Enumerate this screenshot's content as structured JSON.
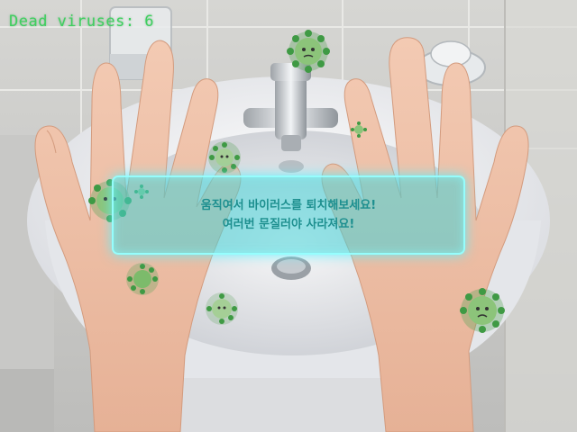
{
  "hud": {
    "dead_label": "Dead viruses: 6"
  },
  "dialog": {
    "line1": "움직여서 바이러스를 퇴치해보세요!",
    "line2": "여러번 문질러야 사라져요!"
  },
  "colors": {
    "virus_fill": "#7dbf6a",
    "virus_dark": "#2f8f3a",
    "hud_text": "#3fcf5f",
    "dialog_border": "#96ffff"
  },
  "viruses": [
    {
      "id": "v1",
      "size": "large"
    },
    {
      "id": "v2",
      "size": "small"
    },
    {
      "id": "v3",
      "size": "medium"
    },
    {
      "id": "v4",
      "size": "large"
    },
    {
      "id": "v5",
      "size": "tiny"
    },
    {
      "id": "v6",
      "size": "medium"
    },
    {
      "id": "v7",
      "size": "medium"
    },
    {
      "id": "v8",
      "size": "large"
    }
  ]
}
